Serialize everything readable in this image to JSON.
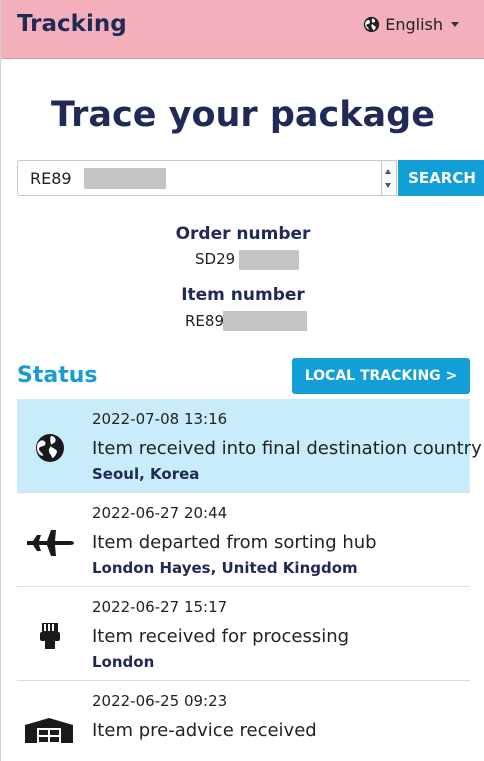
{
  "header": {
    "brand": "Tracking",
    "language": "English"
  },
  "page": {
    "title": "Trace your package"
  },
  "search": {
    "value": "RE89",
    "button_label": "SEARCH"
  },
  "order": {
    "label": "Order number",
    "value": "SD29"
  },
  "item": {
    "label": "Item number",
    "value": "RE89"
  },
  "status": {
    "title": "Status",
    "local_tracking_label": "LOCAL TRACKING >",
    "events": [
      {
        "timestamp": "2022-07-08 13:16",
        "description": "Item received into final destination country",
        "location": "Seoul, Korea",
        "icon": "globe-icon",
        "active": true
      },
      {
        "timestamp": "2022-06-27 20:44",
        "description": "Item departed from sorting hub",
        "location": "London Hayes, United Kingdom",
        "icon": "airplane-icon",
        "active": false
      },
      {
        "timestamp": "2022-06-27 15:17",
        "description": "Item received for processing",
        "location": "London",
        "icon": "scanner-icon",
        "active": false
      },
      {
        "timestamp": "2022-06-25 09:23",
        "description": "Item pre-advice received",
        "location": "",
        "icon": "warehouse-icon",
        "active": false
      }
    ]
  },
  "colors": {
    "header_bg": "#f4b0ba",
    "brand": "#1f2a56",
    "accent": "#129ed6",
    "active_row": "#c9ecfa"
  }
}
